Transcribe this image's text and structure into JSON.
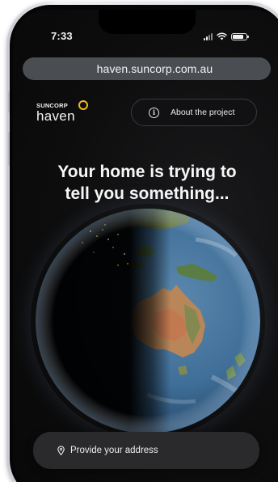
{
  "status_bar": {
    "time": "7:33",
    "signal_bars_active": 2,
    "signal_bars_total": 4,
    "battery_level": 0.85,
    "icons": [
      "signal-icon",
      "wifi-icon",
      "battery-icon"
    ]
  },
  "browser": {
    "url": "haven.suncorp.com.au"
  },
  "header": {
    "logo_brand": "SUNCORP",
    "logo_product": "haven",
    "about_label": "About the project",
    "about_icon": "info-icon"
  },
  "hero": {
    "headline_line1": "Your home is trying to",
    "headline_line2": "tell you something..."
  },
  "cta": {
    "address_label": "Provide your address",
    "address_icon": "location-pin-icon"
  },
  "colors": {
    "background": "#0d0d0e",
    "accent_ring": "#f2b821",
    "url_bar": "#4a4d52",
    "button_dark": "#2a2a2d",
    "ocean": "#3f6e98",
    "land": "#b9865a"
  }
}
